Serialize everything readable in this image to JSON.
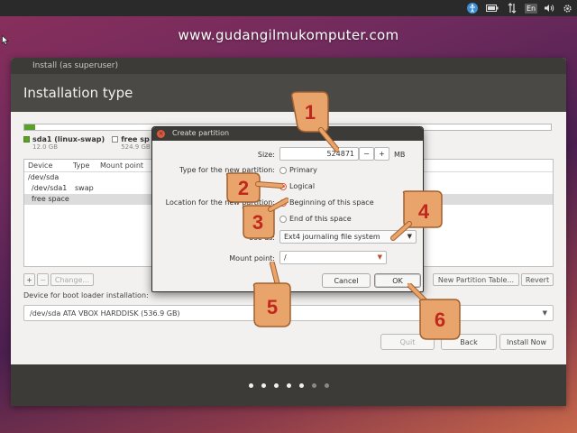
{
  "topbar": {
    "accessibility_icon": "accessibility-icon",
    "battery_icon": "battery-icon",
    "network_icon": "network-icon",
    "keyboard_lang": "En",
    "volume_icon": "volume-icon",
    "settings_icon": "gear-icon"
  },
  "watermark": "www.gudangilmukomputer.com",
  "window": {
    "title": "Install (as superuser)",
    "page_title": "Installation type"
  },
  "disk_bar": {
    "used_fraction": 0.02,
    "legend": [
      {
        "name": "sda1 (linux-swap)",
        "size": "12.0 GB",
        "color": "#5aa02c"
      },
      {
        "name": "free sp",
        "size": "524.9 GB",
        "color": "#ffffff"
      }
    ]
  },
  "partition_table": {
    "headers": [
      "Device",
      "Type",
      "Mount point"
    ],
    "rows": [
      {
        "device": "/dev/sda",
        "type": "",
        "mount": ""
      },
      {
        "device": "/dev/sda1",
        "type": "swap",
        "mount": ""
      },
      {
        "device": "free space",
        "type": "",
        "mount": ""
      }
    ]
  },
  "table_toolbar": {
    "add": "+",
    "remove": "−",
    "change": "Change...",
    "new_table": "New Partition Table...",
    "revert": "Revert"
  },
  "bootloader": {
    "label": "Device for boot loader installation:",
    "value": "/dev/sda ATA VBOX HARDDISK (536.9 GB)"
  },
  "nav": {
    "quit": "Quit",
    "back": "Back",
    "install": "Install Now"
  },
  "progress": {
    "total": 7,
    "current": 5
  },
  "dialog": {
    "title": "Create partition",
    "size_label": "Size:",
    "size_value": "524871",
    "size_unit": "MB",
    "minus": "−",
    "plus": "+",
    "type_label": "Type for the new partition:",
    "type_options": [
      "Primary",
      "Logical"
    ],
    "type_selected": 1,
    "location_label": "Location for the new partition:",
    "location_options": [
      "Beginning of this space",
      "End of this space"
    ],
    "location_selected": 0,
    "use_as_label": "Use as:",
    "use_as_value": "Ext4 journaling file system",
    "mount_label": "Mount point:",
    "mount_value": "/",
    "cancel": "Cancel",
    "ok": "OK"
  },
  "annotations": [
    "1",
    "2",
    "3",
    "4",
    "5",
    "6"
  ]
}
